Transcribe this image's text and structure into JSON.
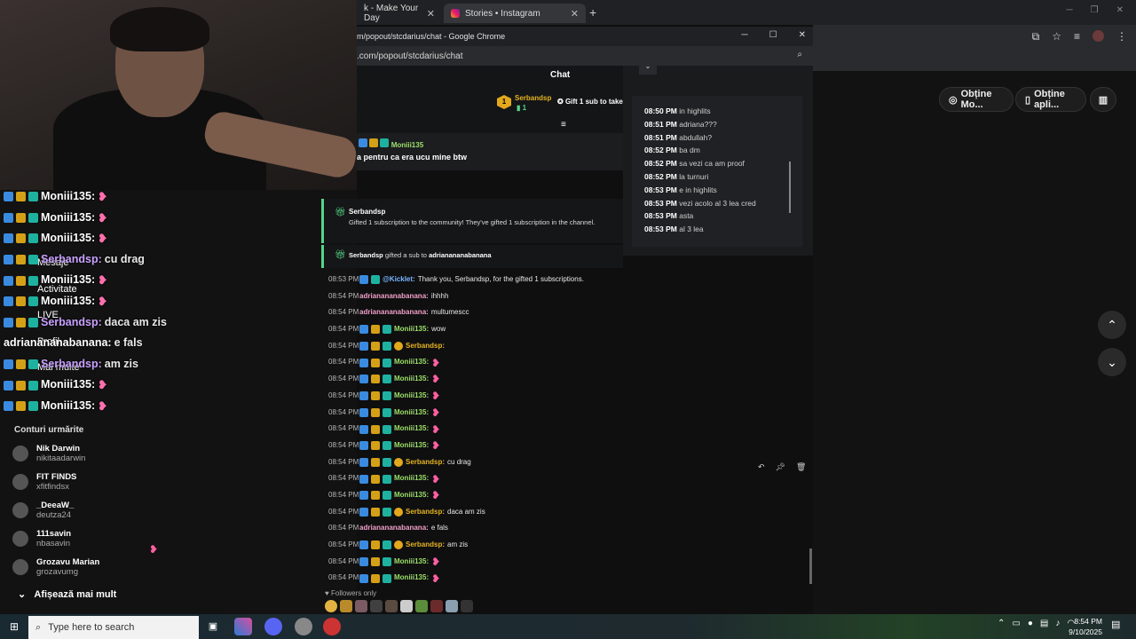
{
  "browser": {
    "tabs": [
      {
        "label": "k - Make Your Day",
        "close": "✕"
      },
      {
        "label": "Stories • Instagram",
        "close": "✕"
      }
    ],
    "new_tab": "+",
    "right_pills": [
      {
        "icon": "coin-icon",
        "label": "Obține Mo..."
      },
      {
        "icon": "phone-icon",
        "label": "Obține apli..."
      }
    ]
  },
  "popup": {
    "title": "m/popout/stcdarius/chat - Google Chrome",
    "url": ".com/popout/stcdarius/chat",
    "chat_title": "Chat",
    "gifter": {
      "rank": "1",
      "name": "Serbandsp",
      "count": "1"
    },
    "gift_button": "Gift 1 sub to take",
    "pinned": {
      "user": "Moniii135",
      "text": "a pentru ca era ucu mine btw"
    },
    "history": [
      {
        "time": "08:50 PM",
        "text": "in highlits"
      },
      {
        "time": "08:51 PM",
        "text": "adriana???"
      },
      {
        "time": "08:51 PM",
        "text": "abdullah?"
      },
      {
        "time": "08:52 PM",
        "text": "ba dm"
      },
      {
        "time": "08:52 PM",
        "text": "sa vezi ca am proof"
      },
      {
        "time": "08:52 PM",
        "text": "la turnuri"
      },
      {
        "time": "08:53 PM",
        "text": "e in highlits"
      },
      {
        "time": "08:53 PM",
        "text": "vezi acolo al 3 lea cred"
      },
      {
        "time": "08:53 PM",
        "text": "asta"
      },
      {
        "time": "08:53 PM",
        "text": "al 3 lea"
      }
    ],
    "gift_notice_1": {
      "user": "Serbandsp",
      "text": "Gifted 1 subscription to the community! They've gifted 1 subscription in the channel."
    },
    "gift_notice_2": {
      "user": "Serbandsp",
      "mid": "gifted a sub to",
      "target": "adrianananabanana"
    },
    "chat": [
      {
        "time": "08:53 PM",
        "user": "@Kicklet",
        "cls": "u-blue",
        "badges": "bot",
        "text": "Thank you, Serbandsp, for the gifted 1 subscriptions."
      },
      {
        "time": "08:54 PM",
        "user": "adrianananabanana",
        "cls": "u-pink",
        "badges": "",
        "text": "ihhhh"
      },
      {
        "time": "08:54 PM",
        "user": "adrianananabanana",
        "cls": "u-pink",
        "badges": "",
        "text": "multumescc"
      },
      {
        "time": "08:54 PM",
        "user": "Moniii135",
        "cls": "u-green",
        "badges": "3",
        "text": "wow"
      },
      {
        "time": "08:54 PM",
        "user": "Serbandsp",
        "cls": "u-orange",
        "badges": "4",
        "text": ""
      },
      {
        "time": "08:54 PM",
        "user": "Moniii135",
        "cls": "u-green",
        "badges": "3",
        "text": "",
        "emote": true
      },
      {
        "time": "08:54 PM",
        "user": "Moniii135",
        "cls": "u-green",
        "badges": "3",
        "text": "",
        "emote": true
      },
      {
        "time": "08:54 PM",
        "user": "Moniii135",
        "cls": "u-green",
        "badges": "3",
        "text": "",
        "emote": true
      },
      {
        "time": "08:54 PM",
        "user": "Moniii135",
        "cls": "u-green",
        "badges": "3",
        "text": "",
        "emote": true
      },
      {
        "time": "08:54 PM",
        "user": "Moniii135",
        "cls": "u-green",
        "badges": "3",
        "text": "",
        "emote": true
      },
      {
        "time": "08:54 PM",
        "user": "Moniii135",
        "cls": "u-green",
        "badges": "3",
        "text": "",
        "emote": true
      },
      {
        "time": "08:54 PM",
        "user": "Serbandsp",
        "cls": "u-orange",
        "badges": "4",
        "text": "cu drag"
      },
      {
        "time": "08:54 PM",
        "user": "Moniii135",
        "cls": "u-green",
        "badges": "3",
        "text": "",
        "emote": true
      },
      {
        "time": "08:54 PM",
        "user": "Moniii135",
        "cls": "u-green",
        "badges": "3",
        "text": "",
        "emote": true
      },
      {
        "time": "08:54 PM",
        "user": "Serbandsp",
        "cls": "u-orange",
        "badges": "4",
        "text": "daca am zis"
      },
      {
        "time": "08:54 PM",
        "user": "adrianananabanana",
        "cls": "u-pink",
        "badges": "",
        "text": "e fals"
      },
      {
        "time": "08:54 PM",
        "user": "Serbandsp",
        "cls": "u-orange",
        "badges": "4",
        "text": "am zis"
      },
      {
        "time": "08:54 PM",
        "user": "Moniii135",
        "cls": "u-green",
        "badges": "3",
        "text": "",
        "emote": true
      },
      {
        "time": "08:54 PM",
        "user": "Moniii135",
        "cls": "u-green",
        "badges": "3",
        "text": "",
        "emote": true
      }
    ],
    "followers_only": "Followers only"
  },
  "overlay_chat": [
    {
      "user": "Moniii135",
      "text": "",
      "heart": true
    },
    {
      "user": "Moniii135",
      "text": "",
      "heart": true
    },
    {
      "user": "Moniii135",
      "text": "",
      "heart": true
    },
    {
      "user": "Serbandsp",
      "text": "cu drag",
      "heart": false
    },
    {
      "user": "Moniii135",
      "text": "",
      "heart": true
    },
    {
      "user": "Moniii135",
      "text": "",
      "heart": true
    },
    {
      "user": "Serbandsp",
      "text": "daca am zis",
      "heart": false
    },
    {
      "user": "adrianananabanana",
      "text": "e fals",
      "heart": false
    },
    {
      "user": "Serbandsp",
      "text": "am zis",
      "heart": false
    },
    {
      "user": "Moniii135",
      "text": "",
      "heart": true
    },
    {
      "user": "Moniii135",
      "text": "",
      "heart": true
    }
  ],
  "side_nav": [
    "Mesaje",
    "Activitate",
    "LIVE",
    "Profil",
    "Mai multe"
  ],
  "following": {
    "title": "Conturi urmărite",
    "accounts": [
      {
        "name": "Nik Darwin",
        "handle": "nikitaadarwin"
      },
      {
        "name": "FIT FINDS",
        "handle": "xfitfindsx"
      },
      {
        "name": "_DeeaW_",
        "handle": "deutza24"
      },
      {
        "name": "111savin",
        "handle": "nbasavin"
      },
      {
        "name": "Grozavu Marian",
        "handle": "grozavumg"
      }
    ],
    "show_more": "Afișează mai mult"
  },
  "taskbar": {
    "search_placeholder": "Type here to search",
    "time": "8:54 PM",
    "date": "9/10/2025"
  }
}
